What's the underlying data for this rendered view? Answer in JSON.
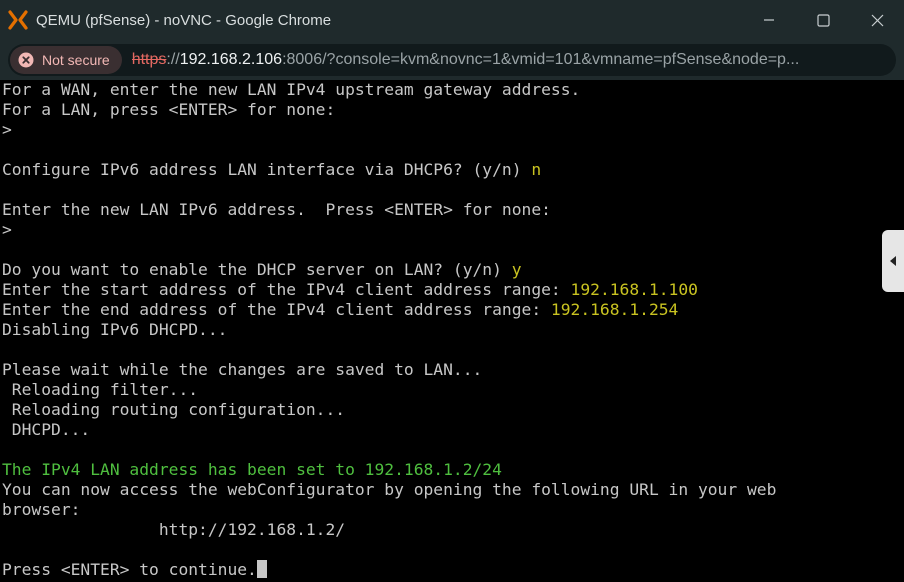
{
  "window": {
    "title": "QEMU (pfSense) - noVNC - Google Chrome"
  },
  "address_bar": {
    "security_label": "Not secure",
    "url_scheme": "https",
    "url_separator": "://",
    "url_host": "192.168.2.106",
    "url_rest": ":8006/?console=kvm&novnc=1&vmid=101&vmname=pfSense&node=p..."
  },
  "console": {
    "lines": [
      {
        "text": "For a WAN, enter the new LAN IPv4 upstream gateway address."
      },
      {
        "text": "For a LAN, press <ENTER> for none:"
      },
      {
        "text": ">"
      },
      {
        "text": ""
      },
      {
        "text": "Configure IPv6 address LAN interface via DHCP6? (y/n) ",
        "input": "n"
      },
      {
        "text": ""
      },
      {
        "text": "Enter the new LAN IPv6 address.  Press <ENTER> for none:"
      },
      {
        "text": ">"
      },
      {
        "text": ""
      },
      {
        "text": "Do you want to enable the DHCP server on LAN? (y/n) ",
        "input": "y"
      },
      {
        "text": "Enter the start address of the IPv4 client address range: ",
        "input": "192.168.1.100"
      },
      {
        "text": "Enter the end address of the IPv4 client address range: ",
        "input": "192.168.1.254"
      },
      {
        "text": "Disabling IPv6 DHCPD..."
      },
      {
        "text": ""
      },
      {
        "text": "Please wait while the changes are saved to LAN..."
      },
      {
        "text": " Reloading filter..."
      },
      {
        "text": " Reloading routing configuration..."
      },
      {
        "text": " DHCPD..."
      },
      {
        "text": ""
      },
      {
        "text": "The IPv4 LAN address has been set to 192.168.1.2/24",
        "style": "green"
      },
      {
        "text": "You can now access the webConfigurator by opening the following URL in your web"
      },
      {
        "text": "browser:"
      },
      {
        "text": "                http://192.168.1.2/"
      },
      {
        "text": ""
      },
      {
        "text": "Press <ENTER> to continue.",
        "cursor": true
      }
    ]
  },
  "colors": {
    "terminal_text": "#c7c7c7",
    "user_input": "#c9c321",
    "success": "#4fbf3f",
    "not_secure": "#f2b8b5"
  },
  "icons": {
    "app": "proxmox-icon",
    "security": "warning-circle-icon",
    "side_handle": "caret-left-icon"
  }
}
